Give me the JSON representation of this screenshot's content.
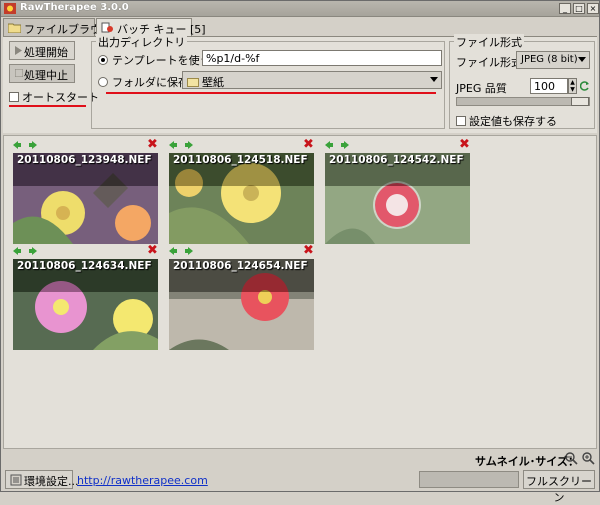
{
  "window": {
    "title": "RawTherapee 3.0.0",
    "min_label": "_",
    "max_label": "□",
    "close_label": "×"
  },
  "tabs": [
    {
      "label": "ファイルブラウザ"
    },
    {
      "label": "バッチ キュー",
      "count": "[5]"
    }
  ],
  "queue": {
    "start_label": "処理開始",
    "stop_label": "処理中止",
    "auto_start_label": "オートスタート"
  },
  "output_dir": {
    "title": "出力ディレクトリ",
    "template_label": "テンプレートを使う：",
    "template_value": "%p1/d-%f",
    "folder_label": "フォルダに保存：",
    "folder_value": "壁紙"
  },
  "file_format": {
    "title": "ファイル形式",
    "format_label": "ファイル形式：",
    "format_value": "JPEG (8 bit)",
    "quality_label": "JPEG 品質",
    "quality_value": "100",
    "quality_level": 1.0,
    "save_params_label": "設定値も保存する"
  },
  "thumbnails": [
    {
      "name": "20110806_123948.NEF",
      "colors": [
        "#4a2a50",
        "#e8d23a",
        "#3d6b1f",
        "#f08a30"
      ]
    },
    {
      "name": "20110806_124518.NEF",
      "colors": [
        "#3c5a22",
        "#f0d84a",
        "#5a7a2e",
        "#e8c23a"
      ]
    },
    {
      "name": "20110806_124542.NEF",
      "colors": [
        "#6f8a5a",
        "#d8203a",
        "#f4f0f0",
        "#4a6a3a"
      ]
    },
    {
      "name": "20110806_124634.NEF",
      "colors": [
        "#1f3a18",
        "#e070c0",
        "#f0e040",
        "#5a8030"
      ]
    },
    {
      "name": "20110806_124654.NEF",
      "colors": [
        "#5a5a4a",
        "#e01a28",
        "#a8a090",
        "#3a4a28"
      ]
    }
  ],
  "thumb_size_label": "サムネイル･サイズ：",
  "status": {
    "env_button_label": "環境設定...",
    "link_text": "http://rawtherapee.com",
    "fullscreen_label": "フルスクリーン"
  },
  "colors": {
    "accent_red": "#e0101a",
    "link_blue": "#1030c8",
    "delete_red": "#c8141b"
  }
}
